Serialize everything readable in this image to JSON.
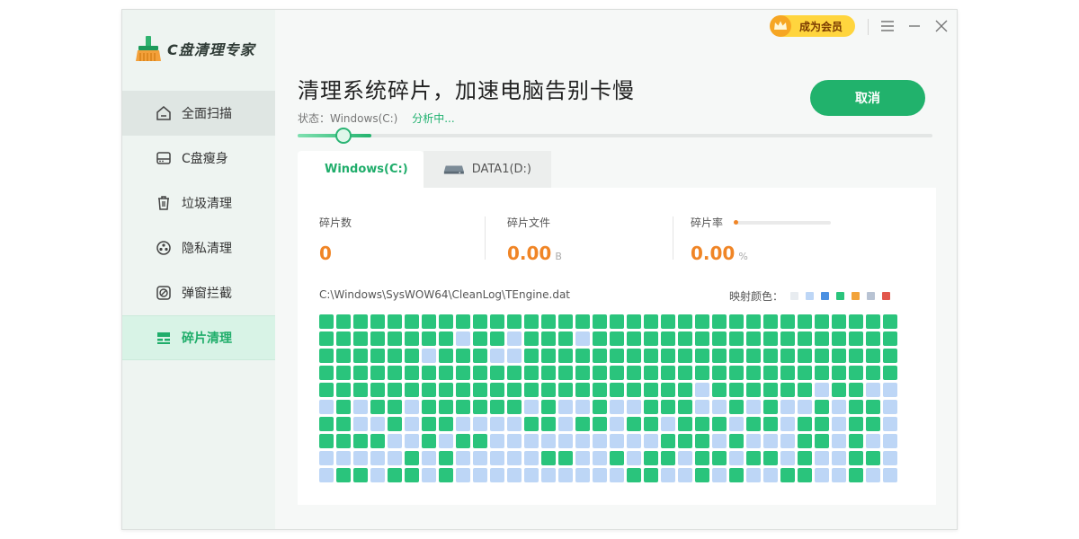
{
  "app": {
    "name": "C盘清理专家",
    "vip_label": "成为会员"
  },
  "sidebar": {
    "items": [
      {
        "label": "全面扫描",
        "icon": "home-icon"
      },
      {
        "label": "C盘瘦身",
        "icon": "disk-icon"
      },
      {
        "label": "垃圾清理",
        "icon": "trash-icon"
      },
      {
        "label": "隐私清理",
        "icon": "privacy-icon"
      },
      {
        "label": "弹窗拦截",
        "icon": "block-icon"
      },
      {
        "label": "碎片清理",
        "icon": "defrag-icon",
        "active": true
      }
    ]
  },
  "header": {
    "title": "清理系统碎片，加速电脑告别卡慢",
    "status_label": "状态：Windows(C:)",
    "status_value": "分析中...",
    "cancel_label": "取消",
    "progress": 0.06
  },
  "tabs": [
    {
      "label": "Windows(C:)",
      "active": true
    },
    {
      "label": "DATA1(D:)",
      "active": false
    }
  ],
  "stats": {
    "fragments_label": "碎片数",
    "fragments_value": "0",
    "files_label": "碎片文件",
    "files_value": "0.00",
    "files_unit": "B",
    "rate_label": "碎片率",
    "rate_value": "0.00",
    "rate_unit": "%"
  },
  "current_path": "C:\\Windows\\SysWOW64\\CleanLog\\TEngine.dat",
  "legend": {
    "label": "映射颜色：",
    "colors": [
      "#e8ecf0",
      "#bdd6f6",
      "#4a90e2",
      "#2ac47c",
      "#f2a33a",
      "#b8c3d3",
      "#e2574c"
    ]
  },
  "colors": {
    "accent": "#21b26c",
    "fragment_used": "#2ac47c",
    "fragment_free": "#bdd6f6",
    "value": "#f08526"
  },
  "block_map": [
    "GGGGGGGGGGGGGGGGGGGGGGGGGGGGGGGGGG",
    "GGGGGGGGBGGBGGGBGGGGGGGGGGGGGGGGGG",
    "GGGGGGBGGGBBGGGGGGGGGGGGGGGGGGGGGG",
    "GGGGGGGGGGGGGGGGGGGGGGGGGGGGGGGGGG",
    "GGGGGGGGGGGGGGGGGGGGGGBGGGGGGBGGBB",
    "BGBGGBGGGGGGBGBBGBBGGGBBGBGBBGBGGB",
    "GGBBGBGGBBBBGGBGGBGGBGGGBGGBGGBGGB",
    "GGGGBBGBGGBBBBBBBBBBGGGBGBBBGGBGBB",
    "BBBBBGBGBBBBBGGBBGBGGBGGBGGBGBBGGB",
    "BGGBGGBGBBBBBBBBBBGGBBGBGBBGGBBGBB"
  ]
}
